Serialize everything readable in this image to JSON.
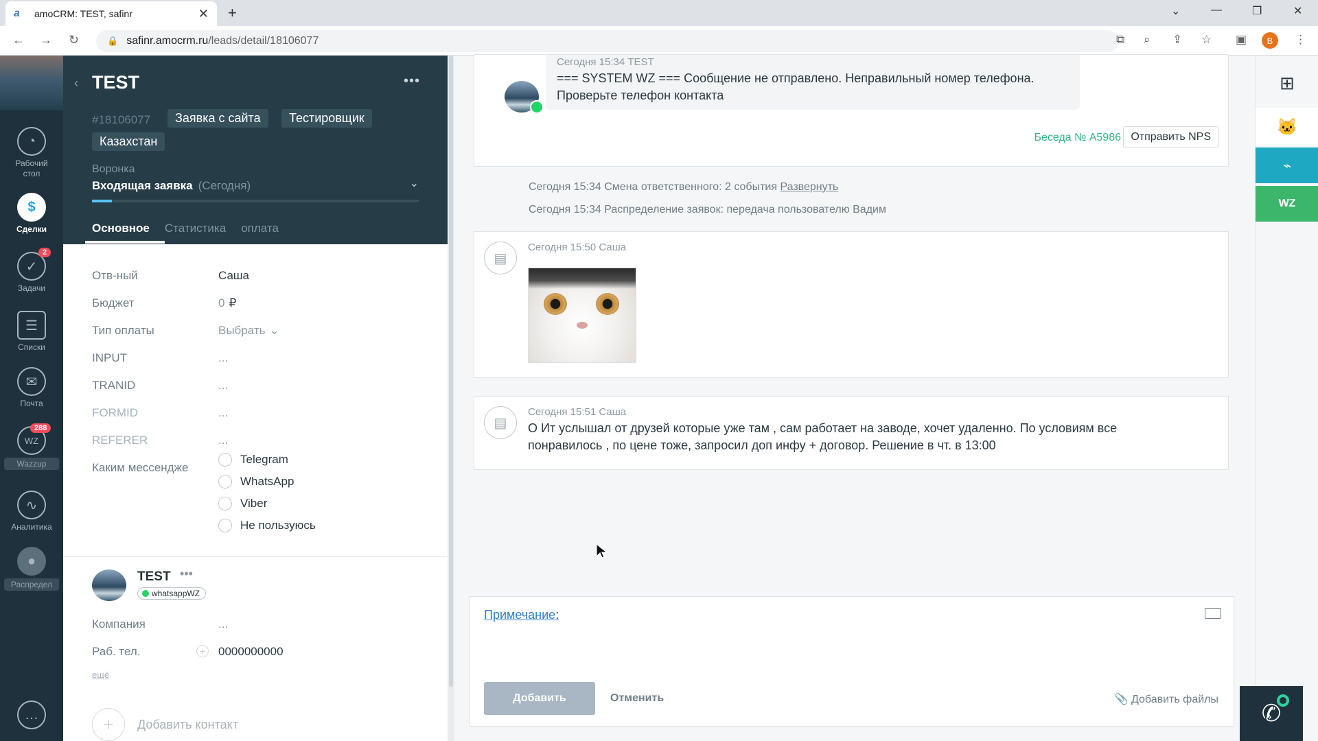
{
  "browser": {
    "tab_title": "amoCRM: TEST, safinr",
    "tab_favicon": "a",
    "url_domain": "safinr.amocrm.ru",
    "url_path": "/leads/detail/18106077",
    "profile_initial": "B"
  },
  "nav": {
    "items": [
      {
        "label": "Рабочий стол",
        "icon": "dashboard-icon"
      },
      {
        "label": "Сделки",
        "icon": "deals-icon"
      },
      {
        "label": "Задачи",
        "icon": "tasks-icon",
        "badge": "2"
      },
      {
        "label": "Списки",
        "icon": "lists-icon"
      },
      {
        "label": "Почта",
        "icon": "mail-icon"
      },
      {
        "label": "Wazzup",
        "icon": "wazzup-icon",
        "badge": "288"
      },
      {
        "label": "Аналитика",
        "icon": "analytics-icon"
      },
      {
        "label": "Распредел",
        "icon": "distribution-icon"
      }
    ]
  },
  "lead": {
    "title": "TEST",
    "id": "#18106077",
    "tags": [
      "Заявка с сайта",
      "Тестировщик",
      "Казахстан"
    ],
    "funnel_label": "Воронка",
    "stage": "Входящая заявка",
    "stage_when": "(Сегодня)",
    "progress_fraction": 0.06,
    "tabs": [
      "Основное",
      "Статистика",
      "оплата"
    ],
    "fields": [
      {
        "key": "Отв-ный",
        "value": "Саша"
      },
      {
        "key": "Бюджет",
        "value": "0",
        "unit": "₽"
      },
      {
        "key": "Тип оплаты",
        "value": "Выбрать"
      },
      {
        "key": "INPUT",
        "value": "..."
      },
      {
        "key": "TRANID",
        "value": "..."
      },
      {
        "key": "FORMID",
        "value": "..."
      },
      {
        "key": "REFERER",
        "value": "..."
      }
    ],
    "messenger_question": "Каким мессендже",
    "messenger_options": [
      "Telegram",
      "WhatsApp",
      "Viber",
      "Не пользуюсь"
    ]
  },
  "contact": {
    "name": "TEST",
    "channel": "whatsappWZ",
    "company_label": "Компания",
    "company_value": "...",
    "phone_label": "Раб. тел.",
    "phone_value": "0000000000",
    "more": "ещё",
    "add_contact": "Добавить контакт"
  },
  "feed": {
    "chat_meta": "Сегодня 15:34 TEST",
    "chat_text_1": "=== SYSTEM WZ === Сообщение не отправлено. Неправильный номер телефона.",
    "chat_text_2": "Проверьте телефон контакта",
    "conversation": "Беседа № A5986",
    "nps_button": "Отправить NPS",
    "sys1_text": "Сегодня 15:34 Смена ответственного: 2 события",
    "sys1_link": "Развернуть",
    "sys2_text": "Сегодня 15:34 Распределение заявок: передача пользователю Вадим",
    "note1_meta": "Сегодня 15:50 Саша",
    "note2_meta": "Сегодня 15:51 Саша",
    "note2_text_1": "О Ит услышал от друзей которые уже там , сам работает на заводе, хочет удаленно. По условиям все",
    "note2_text_2": "понравилось , по цене тоже, запросил доп инфу + договор. Решение в чт. в 13:00"
  },
  "composer": {
    "note_label": "Примечание",
    "add_button": "Добавить",
    "cancel": "Отменить",
    "attach": "Добавить файлы"
  },
  "rightbar": {
    "wz_label": "WZ"
  }
}
